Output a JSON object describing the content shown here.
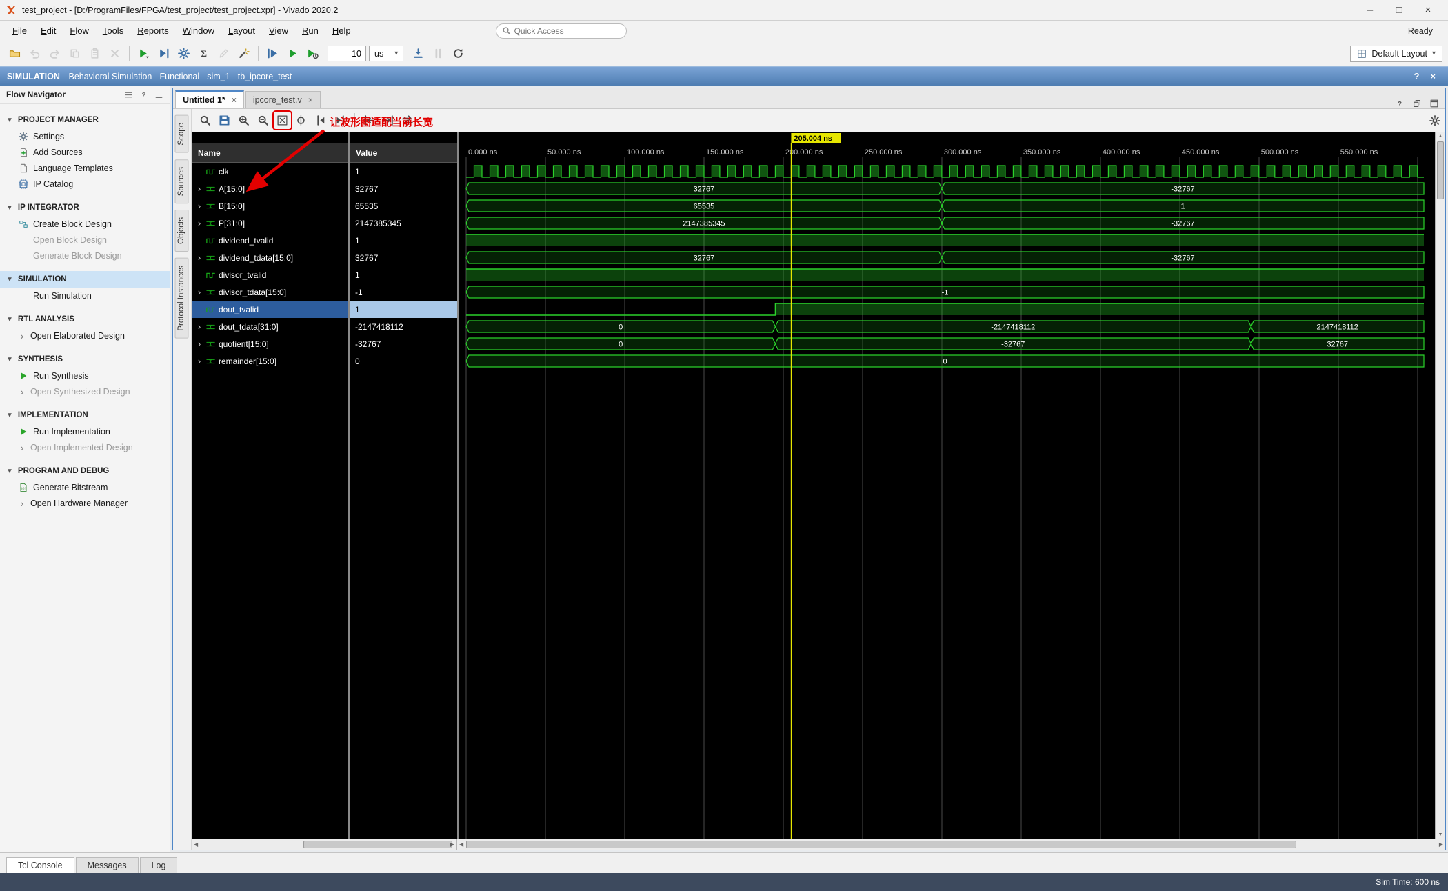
{
  "titlebar": {
    "title": "test_project - [D:/ProgramFiles/FPGA/test_project/test_project.xpr] - Vivado 2020.2"
  },
  "menubar": {
    "items": [
      "File",
      "Edit",
      "Flow",
      "Tools",
      "Reports",
      "Window",
      "Layout",
      "View",
      "Run",
      "Help"
    ],
    "quick_access_placeholder": "Quick Access",
    "ready": "Ready"
  },
  "toolbar": {
    "buttons_left": [
      {
        "name": "open",
        "icon": "folder",
        "enabled": true
      },
      {
        "name": "undo",
        "icon": "undo",
        "enabled": false
      },
      {
        "name": "redo",
        "icon": "redo",
        "enabled": false
      },
      {
        "name": "copy",
        "icon": "copy",
        "enabled": false
      },
      {
        "name": "paste",
        "icon": "paste",
        "enabled": false
      },
      {
        "name": "delete",
        "icon": "xmark",
        "enabled": false
      },
      {
        "name": "sep"
      },
      {
        "name": "run",
        "icon": "play-menu",
        "enabled": true,
        "color": "#1f9e2e"
      },
      {
        "name": "step-over",
        "icon": "play-bar",
        "enabled": true,
        "color": "#3a6ea5"
      },
      {
        "name": "settings",
        "icon": "gear",
        "enabled": true,
        "color": "#3a6ea5"
      },
      {
        "name": "report",
        "icon": "sigma",
        "enabled": true,
        "color": "#444444"
      },
      {
        "name": "edit",
        "icon": "pencil",
        "enabled": false
      },
      {
        "name": "critical-path",
        "icon": "wand",
        "enabled": true,
        "color": "#555555"
      },
      {
        "name": "sep"
      },
      {
        "name": "restart",
        "icon": "bar-play",
        "enabled": true,
        "color": "#3a6ea5"
      },
      {
        "name": "run-all",
        "icon": "play",
        "enabled": true,
        "color": "#1f9e2e"
      },
      {
        "name": "run-for",
        "icon": "play-clock",
        "enabled": true,
        "color": "#1f9e2e"
      }
    ],
    "run_time_value": "10",
    "run_time_unit": "us",
    "buttons_right": [
      {
        "name": "step",
        "icon": "step",
        "enabled": true,
        "color": "#3a6ea5"
      },
      {
        "name": "pause",
        "icon": "pause",
        "enabled": false
      },
      {
        "name": "relaunch",
        "icon": "reload",
        "enabled": true,
        "color": "#444444"
      }
    ],
    "layout_label": "Default Layout"
  },
  "sim_banner": {
    "title": "SIMULATION",
    "rest": "- Behavioral Simulation - Functional - sim_1 - tb_ipcore_test"
  },
  "flow_navigator": {
    "title": "Flow Navigator",
    "sections": [
      {
        "label": "PROJECT MANAGER",
        "items": [
          {
            "label": "Settings",
            "icon": "gear",
            "color": "#5f7285",
            "enabled": true
          },
          {
            "label": "Add Sources",
            "icon": "doc-plus",
            "color": "#7a7a7a",
            "enabled": true
          },
          {
            "label": "Language Templates",
            "icon": "doc",
            "color": "#7a7a7a",
            "enabled": true
          },
          {
            "label": "IP Catalog",
            "icon": "ip",
            "color": "#3a6ea5",
            "enabled": true
          }
        ]
      },
      {
        "label": "IP INTEGRATOR",
        "items": [
          {
            "label": "Create Block Design",
            "icon": "block",
            "color": "#3a8fa0",
            "enabled": true
          },
          {
            "label": "Open Block Design",
            "icon": "none",
            "enabled": false
          },
          {
            "label": "Generate Block Design",
            "icon": "none",
            "enabled": false
          }
        ]
      },
      {
        "label": "SIMULATION",
        "selected": true,
        "items": [
          {
            "label": "Run Simulation",
            "icon": "none",
            "enabled": true
          }
        ]
      },
      {
        "label": "RTL ANALYSIS",
        "items": [
          {
            "label": "Open Elaborated Design",
            "icon": "chevron",
            "enabled": true
          }
        ]
      },
      {
        "label": "SYNTHESIS",
        "items": [
          {
            "label": "Run Synthesis",
            "icon": "play",
            "color": "#2ba52b",
            "enabled": true
          },
          {
            "label": "Open Synthesized Design",
            "icon": "chevron",
            "enabled": false
          }
        ]
      },
      {
        "label": "IMPLEMENTATION",
        "items": [
          {
            "label": "Run Implementation",
            "icon": "play",
            "color": "#2ba52b",
            "enabled": true
          },
          {
            "label": "Open Implemented Design",
            "icon": "chevron",
            "enabled": false
          }
        ]
      },
      {
        "label": "PROGRAM AND DEBUG",
        "items": [
          {
            "label": "Generate Bitstream",
            "icon": "bitstream",
            "color": "#3a8a3a",
            "enabled": true
          },
          {
            "label": "Open Hardware Manager",
            "icon": "chevron",
            "enabled": true
          }
        ]
      }
    ]
  },
  "editor": {
    "tabs": [
      {
        "label": "Untitled 1*",
        "active": true
      },
      {
        "label": "ipcore_test.v",
        "active": false
      }
    ],
    "side_tabs": [
      "Scope",
      "Sources",
      "Objects",
      "Protocol Instances"
    ]
  },
  "wave_toolbar": {
    "buttons": [
      {
        "name": "find",
        "icon": "magnifier"
      },
      {
        "name": "save",
        "icon": "floppy",
        "color": "#3a6ea5"
      },
      {
        "name": "zoom-in",
        "icon": "mag-plus"
      },
      {
        "name": "zoom-out",
        "icon": "mag-minus"
      },
      {
        "name": "zoom-fit",
        "icon": "zoom-fit",
        "boxed": true
      },
      {
        "name": "zoom-to-cursor",
        "icon": "zoom-cursor"
      },
      {
        "name": "prev-transition",
        "icon": "edge-prev"
      },
      {
        "name": "next-transition",
        "icon": "edge-next"
      },
      {
        "name": "sep"
      },
      {
        "name": "goto-start",
        "icon": "goto-start"
      },
      {
        "name": "goto-end",
        "icon": "goto-end"
      },
      {
        "name": "swap-cursors",
        "icon": "swap"
      }
    ],
    "annotation": "让波形图适配当前长宽"
  },
  "wave": {
    "name_header": "Name",
    "value_header": "Value",
    "cursor_time_label": "205.004 ns",
    "cursor_ns": 205.004,
    "time_end_ns": 604,
    "tick_interval_ns": 50,
    "tick_labels": [
      "0.000 ns",
      "50.000 ns",
      "100.000 ns",
      "150.000 ns",
      "200.000 ns",
      "250.000 ns",
      "300.000 ns",
      "350.000 ns",
      "400.000 ns",
      "450.000 ns",
      "500.000 ns",
      "550.000 ns"
    ],
    "colors": {
      "wave": "#2bd12b",
      "label": "#ffffff",
      "cursor": "#e6e600",
      "grid": "#4a4a4a"
    },
    "signals": [
      {
        "name": "clk",
        "value": "1",
        "kind": "clock",
        "half_period_ns": 5
      },
      {
        "name": "A[15:0]",
        "value": "32767",
        "kind": "bus",
        "segments": [
          {
            "t": 0,
            "label": "32767"
          },
          {
            "t": 300,
            "label": "-32767"
          }
        ]
      },
      {
        "name": "B[15:0]",
        "value": "65535",
        "kind": "bus",
        "segments": [
          {
            "t": 0,
            "label": "65535"
          },
          {
            "t": 300,
            "label": "1"
          }
        ]
      },
      {
        "name": "P[31:0]",
        "value": "2147385345",
        "kind": "bus",
        "segments": [
          {
            "t": 0,
            "label": "2147385345"
          },
          {
            "t": 300,
            "label": "-32767"
          }
        ]
      },
      {
        "name": "dividend_tvalid",
        "value": "1",
        "kind": "scalar",
        "edges": [
          {
            "t": 0,
            "v": 1
          }
        ]
      },
      {
        "name": "dividend_tdata[15:0]",
        "value": "32767",
        "kind": "bus",
        "segments": [
          {
            "t": 0,
            "label": "32767"
          },
          {
            "t": 300,
            "label": "-32767"
          }
        ]
      },
      {
        "name": "divisor_tvalid",
        "value": "1",
        "kind": "scalar",
        "edges": [
          {
            "t": 0,
            "v": 1
          }
        ]
      },
      {
        "name": "divisor_tdata[15:0]",
        "value": "-1",
        "kind": "bus",
        "segments": [
          {
            "t": 0,
            "label": "-1"
          }
        ]
      },
      {
        "name": "dout_tvalid",
        "value": "1",
        "kind": "scalar",
        "selected": true,
        "edges": [
          {
            "t": 0,
            "v": 0
          },
          {
            "t": 195,
            "v": 1
          }
        ]
      },
      {
        "name": "dout_tdata[31:0]",
        "value": "-2147418112",
        "kind": "bus",
        "segments": [
          {
            "t": 0,
            "label": "0"
          },
          {
            "t": 195,
            "label": "-2147418112"
          },
          {
            "t": 495,
            "label": "2147418112"
          }
        ]
      },
      {
        "name": "quotient[15:0]",
        "value": "-32767",
        "kind": "bus",
        "segments": [
          {
            "t": 0,
            "label": "0"
          },
          {
            "t": 195,
            "label": "-32767"
          },
          {
            "t": 495,
            "label": "32767"
          }
        ]
      },
      {
        "name": "remainder[15:0]",
        "value": "0",
        "kind": "bus",
        "segments": [
          {
            "t": 0,
            "label": "0"
          }
        ]
      }
    ]
  },
  "console": {
    "tabs": [
      "Tcl Console",
      "Messages",
      "Log"
    ]
  },
  "statusbar": {
    "sim_time": "Sim Time: 600 ns"
  },
  "glyphs": {
    "minimize": "–",
    "maximize": "□",
    "close": "×",
    "dropdown": "▾",
    "help": "?",
    "chevron_right": "›",
    "section_collapse": "▼",
    "up": "▲",
    "down": "▼",
    "left": "◀",
    "right": "▶"
  }
}
